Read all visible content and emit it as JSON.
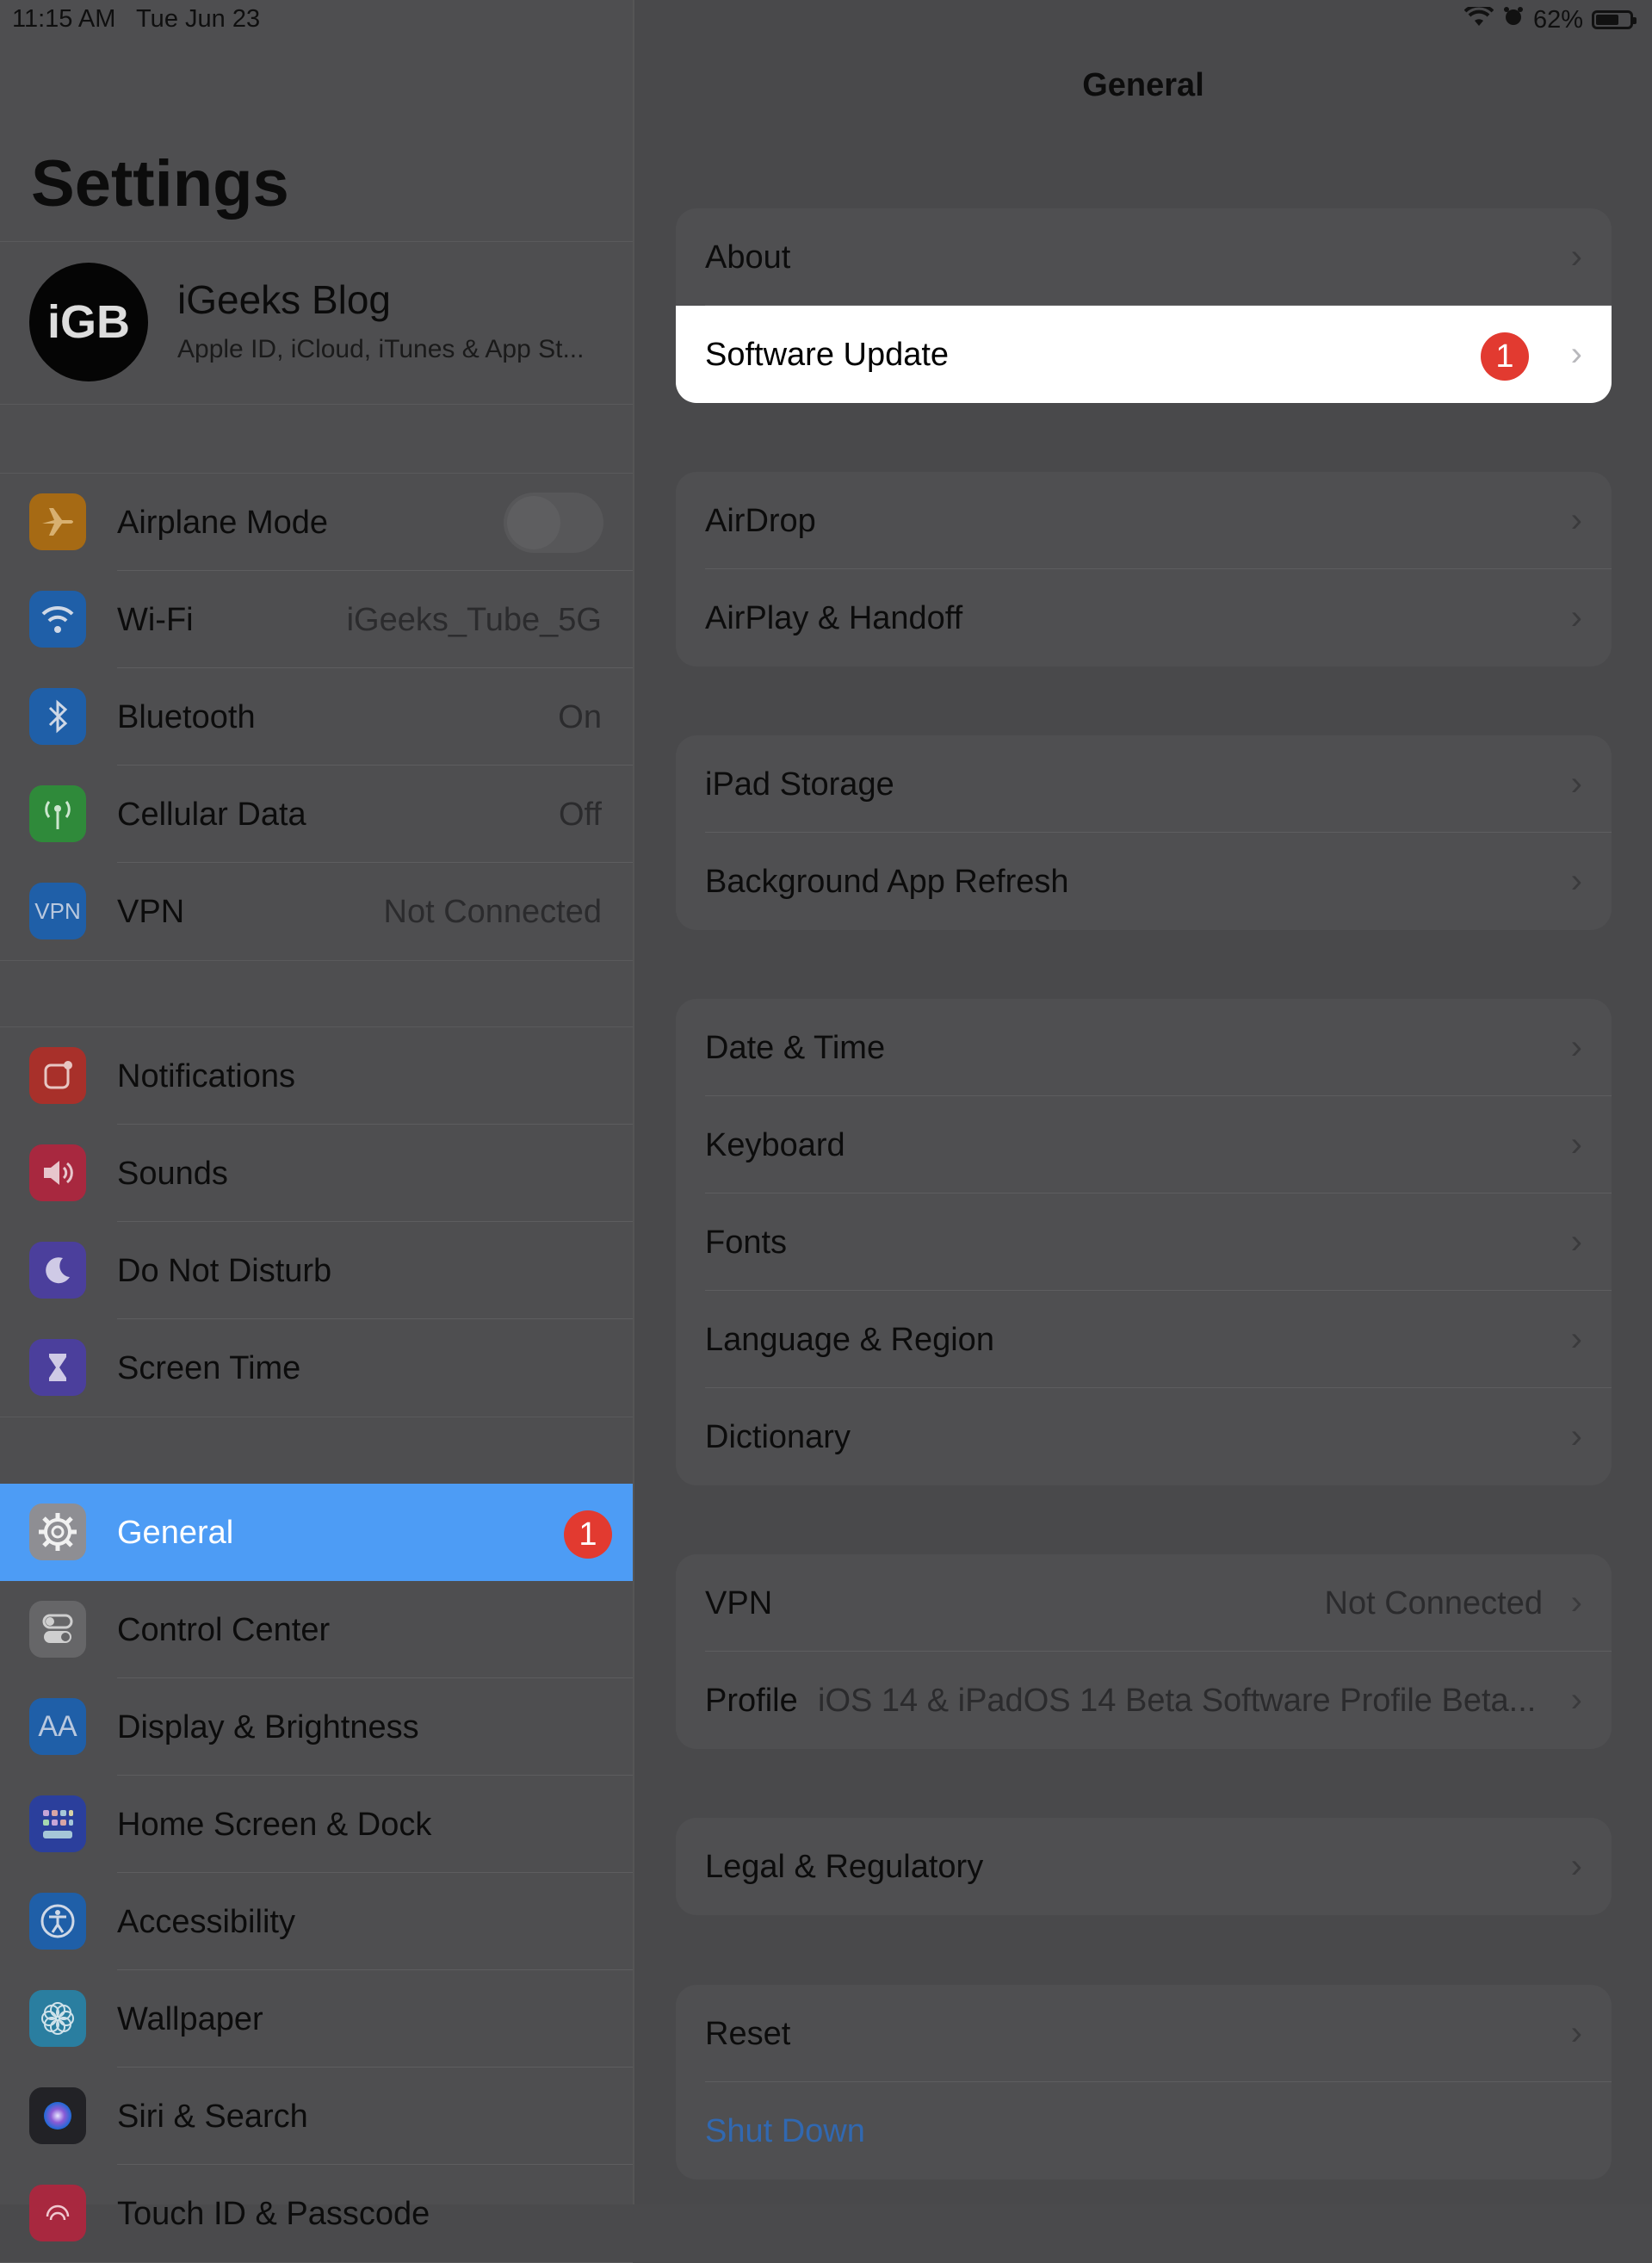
{
  "status": {
    "time": "11:15 AM",
    "date": "Tue Jun 23",
    "battery": "62%",
    "battery_level": 0.62
  },
  "sidebar": {
    "title": "Settings",
    "profile": {
      "avatar": "iGB",
      "name": "iGeeks Blog",
      "sub": "Apple ID, iCloud, iTunes & App St..."
    },
    "group1": [
      {
        "label": "Airplane Mode",
        "icon": "airplane-icon",
        "color": "#a66a14",
        "toggle": false
      },
      {
        "label": "Wi-Fi",
        "value": "iGeeks_Tube_5G",
        "icon": "wifi-icon",
        "color": "#1f5fa8"
      },
      {
        "label": "Bluetooth",
        "value": "On",
        "icon": "bluetooth-icon",
        "color": "#1f5fa8"
      },
      {
        "label": "Cellular Data",
        "value": "Off",
        "icon": "antenna-icon",
        "color": "#2f8a3a"
      },
      {
        "label": "VPN",
        "value": "Not Connected",
        "icon": "vpn-icon",
        "color": "#1f5fa8",
        "icon_text": "VPN"
      }
    ],
    "group2": [
      {
        "label": "Notifications",
        "icon": "notifications-icon",
        "color": "#a8302a"
      },
      {
        "label": "Sounds",
        "icon": "speaker-icon",
        "color": "#a8283f"
      },
      {
        "label": "Do Not Disturb",
        "icon": "moon-icon",
        "color": "#4b3f9c"
      },
      {
        "label": "Screen Time",
        "icon": "hourglass-icon",
        "color": "#4b3f9c"
      }
    ],
    "group3": [
      {
        "label": "General",
        "icon": "gear-icon",
        "color": "#8e8e93",
        "badge": "1",
        "selected": true
      },
      {
        "label": "Control Center",
        "icon": "switches-icon",
        "color": "#666668"
      },
      {
        "label": "Display & Brightness",
        "icon": "text-size-icon",
        "color": "#1f5fa8",
        "icon_text": "AA"
      },
      {
        "label": "Home Screen & Dock",
        "icon": "grid-icon",
        "color": "#2b3f9c"
      },
      {
        "label": "Accessibility",
        "icon": "accessibility-icon",
        "color": "#1f5fa8"
      },
      {
        "label": "Wallpaper",
        "icon": "flower-icon",
        "color": "#2a7ea0"
      },
      {
        "label": "Siri & Search",
        "icon": "siri-icon",
        "color": "#222226"
      },
      {
        "label": "Touch ID & Passcode",
        "icon": "fingerprint-icon",
        "color": "#a8283f"
      }
    ]
  },
  "detail": {
    "title": "General",
    "sections": [
      [
        {
          "label": "About"
        },
        {
          "label": "Software Update",
          "badge": "1",
          "highlight": true
        }
      ],
      [
        {
          "label": "AirDrop"
        },
        {
          "label": "AirPlay & Handoff"
        }
      ],
      [
        {
          "label": "iPad Storage"
        },
        {
          "label": "Background App Refresh"
        }
      ],
      [
        {
          "label": "Date & Time"
        },
        {
          "label": "Keyboard"
        },
        {
          "label": "Fonts"
        },
        {
          "label": "Language & Region"
        },
        {
          "label": "Dictionary"
        }
      ],
      [
        {
          "label": "VPN",
          "value": "Not Connected"
        },
        {
          "label": "Profile",
          "value": "iOS 14 & iPadOS 14 Beta Software Profile Beta...",
          "value_left": true
        }
      ],
      [
        {
          "label": "Legal & Regulatory"
        }
      ],
      [
        {
          "label": "Reset"
        },
        {
          "label": "Shut Down",
          "link": true
        }
      ]
    ]
  }
}
